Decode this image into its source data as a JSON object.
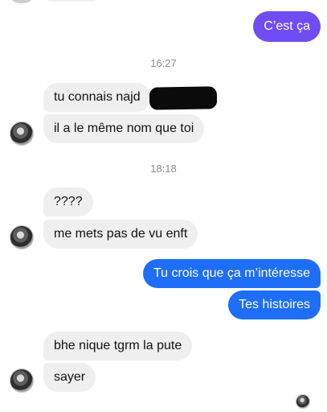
{
  "conversation": {
    "messages": [
      {
        "text": "C’est ça",
        "from": "me"
      },
      {
        "text": "tu connais najd",
        "from": "them"
      },
      {
        "text": "il a le même nom que toi",
        "from": "them"
      },
      {
        "text": "????",
        "from": "them"
      },
      {
        "text": "me mets pas de vu enft",
        "from": "them"
      },
      {
        "text": "Tu crois que ça m’intéresse",
        "from": "me"
      },
      {
        "text": "Tes histoires",
        "from": "me"
      },
      {
        "text": "bhe nique tgrm la pute",
        "from": "them"
      },
      {
        "text": "sayer",
        "from": "them"
      }
    ],
    "timestamps": [
      "16:27",
      "18:18"
    ]
  },
  "colors": {
    "incoming_bubble": "#efefef",
    "outgoing_bubble": "#1e6ef7",
    "outgoing_bubble_first": "#6f4df2",
    "timestamp_text": "#8a8a8a"
  }
}
